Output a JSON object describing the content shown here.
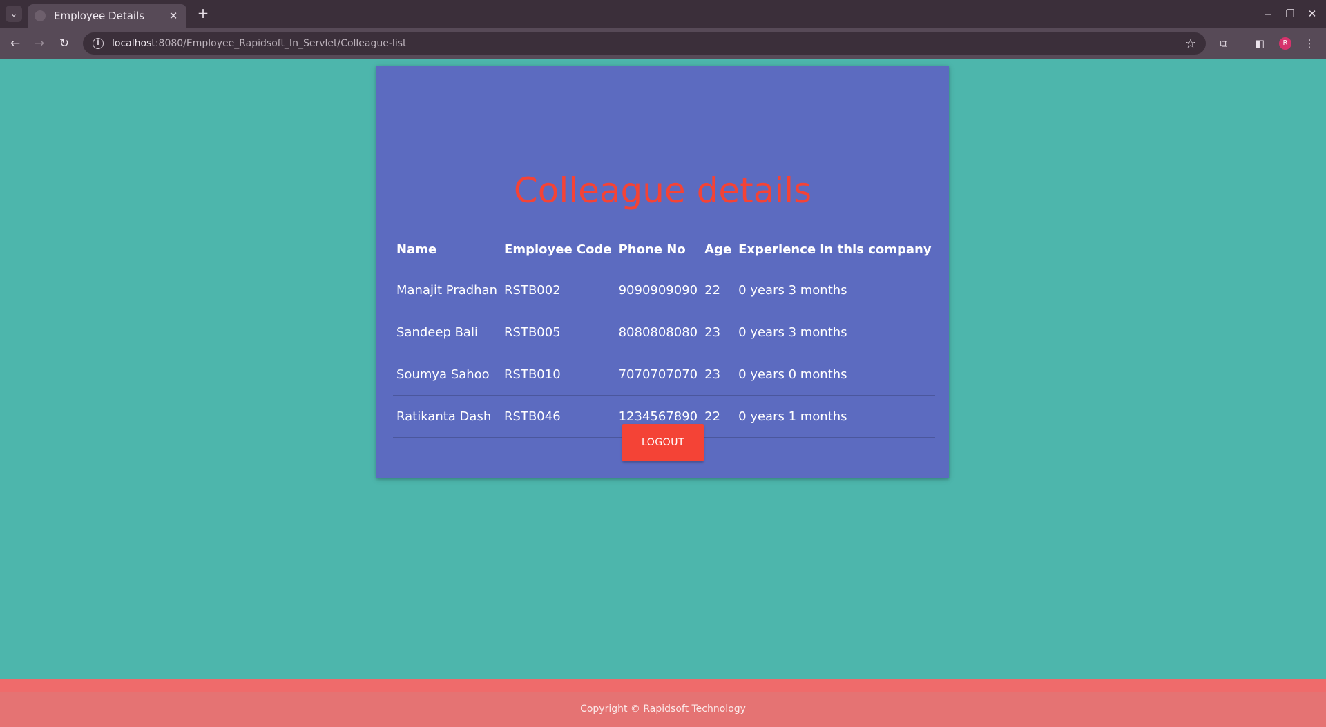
{
  "browser": {
    "tab_title": "Employee Details",
    "tab_close": "✕",
    "new_tab": "+",
    "url_host": "localhost",
    "url_path": ":8080/Employee_Rapidsoft_In_Servlet/Colleague-list",
    "profile_initial": "R"
  },
  "page": {
    "title": "Colleague details",
    "table": {
      "headers": [
        "Name",
        "Employee Code",
        "Phone No",
        "Age",
        "Experience in this company"
      ],
      "rows": [
        [
          "Manajit Pradhan",
          "RSTB002",
          "9090909090",
          "22",
          "0 years 3 months"
        ],
        [
          "Sandeep Bali",
          "RSTB005",
          "8080808080",
          "23",
          "0 years 3 months"
        ],
        [
          "Soumya Sahoo",
          "RSTB010",
          "7070707070",
          "23",
          "0 years 0 months"
        ],
        [
          "Ratikanta Dash",
          "RSTB046",
          "1234567890",
          "22",
          "0 years 1 months"
        ]
      ]
    },
    "logout_label": "LOGOUT"
  },
  "footer": {
    "copyright": "Copyright © Rapidsoft Technology"
  },
  "colors": {
    "background": "#4db6ac",
    "card": "#5c6bc0",
    "accent": "#f44336",
    "footer": "#e57373"
  }
}
